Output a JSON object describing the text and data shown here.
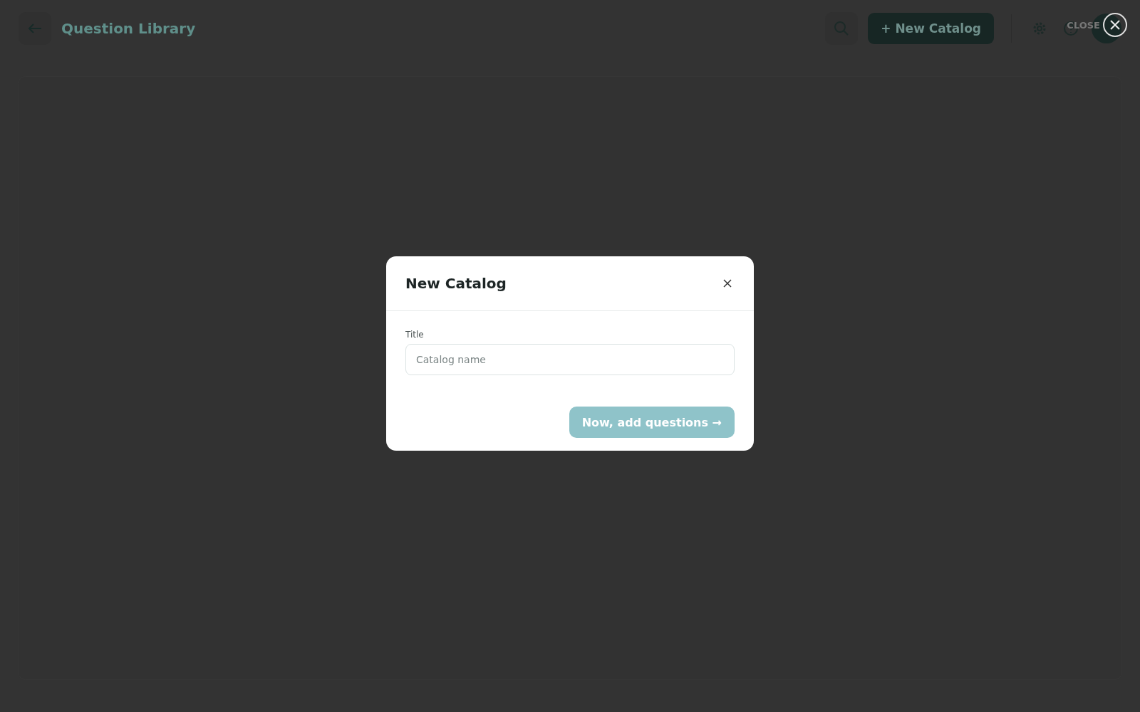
{
  "header": {
    "title": "Question Library",
    "new_button": "+ New Catalog"
  },
  "overlay_close": {
    "label": "CLOSE"
  },
  "dialog": {
    "title": "New Catalog",
    "field": {
      "label": "Title",
      "placeholder": "Catalog name"
    },
    "submit": {
      "label": "Now, add questions →",
      "disabled": true
    }
  }
}
